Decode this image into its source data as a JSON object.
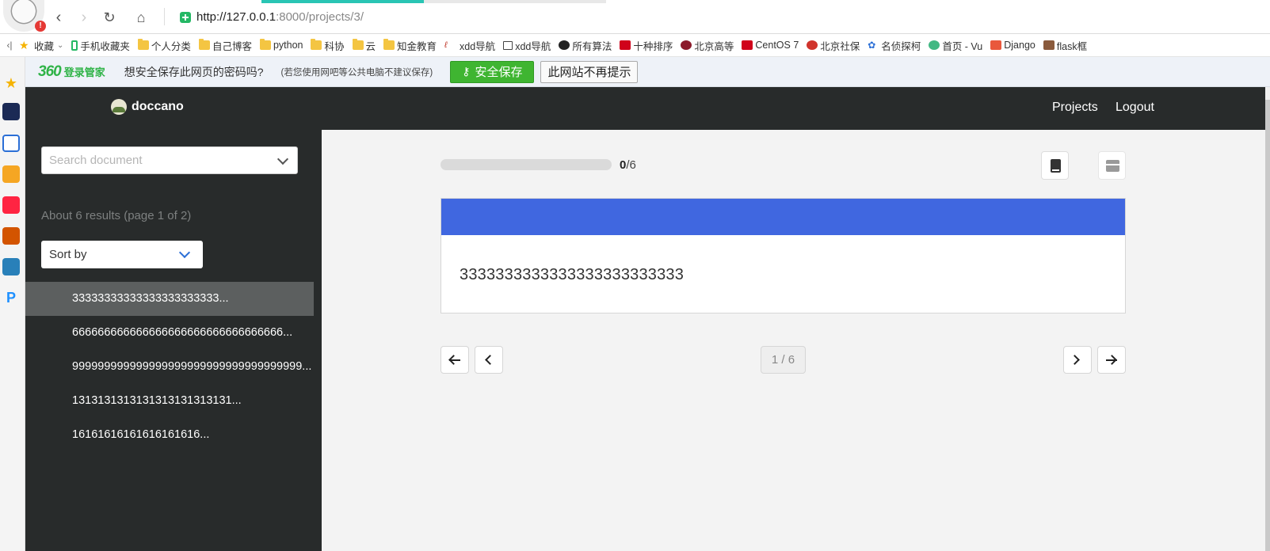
{
  "browser": {
    "url_host": "http://127.0.0.1",
    "url_path": ":8000/projects/3/",
    "avatar_badge": "!",
    "bookmarks_arrow": "‹|",
    "bookmarks": [
      {
        "label": "收藏",
        "icon": "star-icon"
      },
      {
        "label": "手机收藏夹",
        "icon": "phone-icon"
      },
      {
        "label": "个人分类",
        "icon": "folder-icon"
      },
      {
        "label": "自己博客",
        "icon": "folder-icon"
      },
      {
        "label": "python",
        "icon": "folder-icon"
      },
      {
        "label": "科协",
        "icon": "folder-icon"
      },
      {
        "label": "云",
        "icon": "folder-icon"
      },
      {
        "label": "知金教育",
        "icon": "folder-icon"
      },
      {
        "label": "xdd导航",
        "icon": "link-icon"
      },
      {
        "label": "xdd导航",
        "icon": "book-icon"
      },
      {
        "label": "所有算法",
        "icon": "github-icon"
      },
      {
        "label": "十种排序",
        "icon": "csdn-icon"
      },
      {
        "label": "北京高等",
        "icon": "site-icon"
      },
      {
        "label": "CentOS 7",
        "icon": "csdn-icon"
      },
      {
        "label": "北京社保",
        "icon": "site-icon"
      },
      {
        "label": "名侦探柯",
        "icon": "paw-icon"
      },
      {
        "label": "首页 - Vu",
        "icon": "vue-icon"
      },
      {
        "label": "Django",
        "icon": "jianshu-icon"
      },
      {
        "label": "flask框",
        "icon": "site-icon"
      }
    ]
  },
  "banner": {
    "brand": "360",
    "brand_label": "登录管家",
    "question": "想安全保存此网页的密码吗?",
    "note": "(若您使用网吧等公共电脑不建议保存)",
    "save_label": "安全保存",
    "never_label": "此网站不再提示"
  },
  "app": {
    "logo": "doccano",
    "nav_projects": "Projects",
    "nav_logout": "Logout"
  },
  "sidebar": {
    "search_placeholder": "Search document",
    "results_text": "About 6 results (page 1 of 2)",
    "sort_label": "Sort by",
    "documents": [
      {
        "text": "33333333333333333333333..."
      },
      {
        "text": "666666666666666666666666666666666..."
      },
      {
        "text": "999999999999999999999999999999999999..."
      },
      {
        "text": "1313131313131313131313131..."
      },
      {
        "text": "16161616161616161616..."
      }
    ]
  },
  "main": {
    "progress_done": "0",
    "progress_total": "/6",
    "progress_fraction": 0,
    "document_text": "3333333333333333333333333",
    "page_indicator": "1 / 6"
  },
  "colors": {
    "accent": "#4067e0",
    "nav_bg": "#282b2b",
    "save_green": "#3fb531"
  }
}
